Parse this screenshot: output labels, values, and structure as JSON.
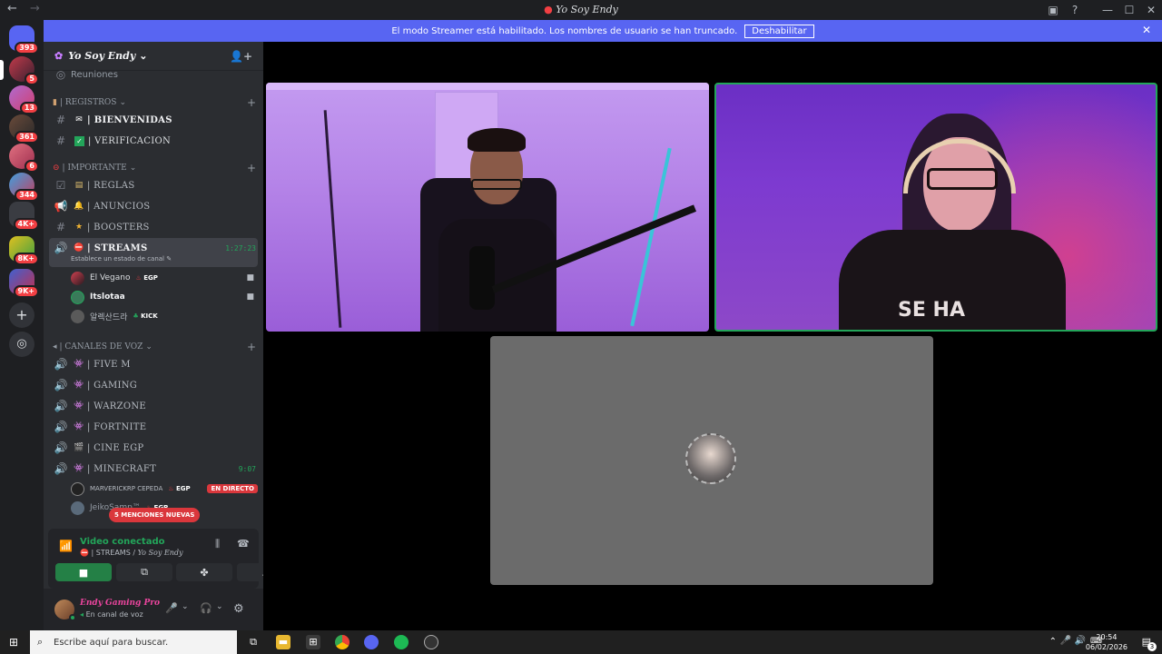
{
  "window": {
    "title": "Yo Soy Endy",
    "back_icon": "←",
    "fwd_icon": "→",
    "ctl": {
      "inbox": "▣",
      "help": "?",
      "min": "—",
      "max": "☐",
      "close": "✕"
    }
  },
  "banner": {
    "text": "El modo Streamer está habilitado. Los nombres de usuario se han truncado.",
    "button": "Deshabilitar",
    "close": "✕"
  },
  "guilds": {
    "badges": [
      "393",
      "5",
      "13",
      "361",
      "6",
      "344",
      "4K+",
      "8K+",
      "9K+"
    ],
    "add": "+",
    "explore": "◎"
  },
  "server": {
    "name": "Yo Soy Endy",
    "chevron": "⌄",
    "invite_icon": "👤+"
  },
  "channels": {
    "partial": "Reuniones",
    "cat_registros": "| REGISTROS",
    "bienvenidas": "| BIENVENIDAS",
    "verificacion": "| VERIFICACION",
    "cat_importante": "| IMPORTANTE",
    "reglas": "| REGLAS",
    "anuncios": "| ANUNCIOS",
    "boosters": "| BOOSTERS",
    "streams": "| STREAMS",
    "streams_time": "1:27:23",
    "streams_status": "Establece un estado de canal",
    "cat_voz": "| CANALES DE VOZ",
    "fivem": "| FIVE M",
    "gaming": "|  GAMING",
    "warzone": "| WARZONE",
    "fortnite": "| FORTNITE",
    "cine": "| CINE EGP",
    "minecraft": "| MINECRAFT",
    "minecraft_time": "9:07",
    "plus": "+",
    "cat_chev": "⌄"
  },
  "users": {
    "u1": "El Vegano",
    "u1_tag": "EGP",
    "u2": "Itslotaa",
    "u3": "알렉산드라",
    "u3_tag": "KICK",
    "u4": "MARVERICKRP CEPEDA",
    "u4_tag": "EGP",
    "u5": "JeikoSamp™",
    "u5_tag": "EGP",
    "live": "EN DIRECTO"
  },
  "mentions": "5 MENCIONES NUEVAS",
  "voice": {
    "title": "Video conectado",
    "sub_chan": "| STREAMS",
    "sub_sep": " / ",
    "sub_server": "Yo Soy Endy"
  },
  "userbar": {
    "name": "Endy Gaming Pro",
    "status": "En canal de voz"
  },
  "taskbar": {
    "search": "Escribe aquí para buscar.",
    "time": "20:54",
    "date": "06/02/2026",
    "notif": "3"
  },
  "colors": {
    "accent": "#5865f2",
    "green": "#23a55a",
    "red": "#da373c"
  }
}
